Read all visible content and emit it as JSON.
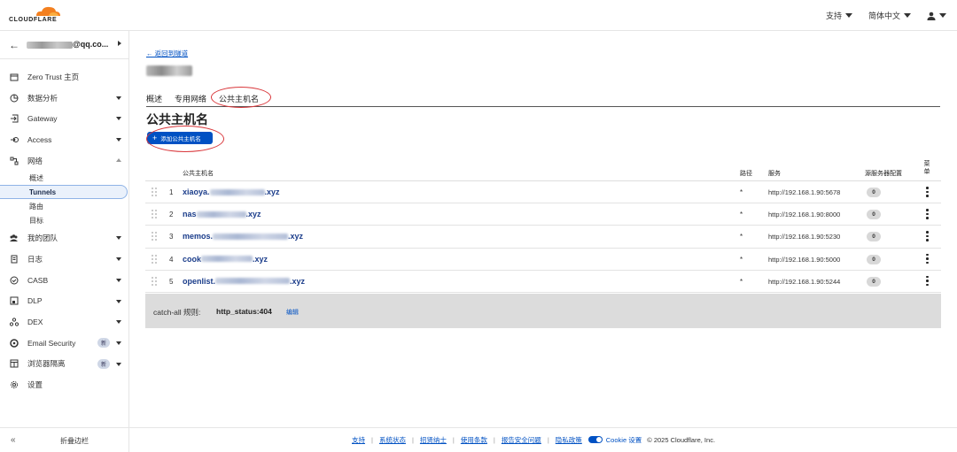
{
  "header": {
    "logo_text": "CLOUDFLARE",
    "support_label": "支持",
    "language_label": "简体中文"
  },
  "sidebar": {
    "account_name": "@qq.co...",
    "items": [
      {
        "label": "Zero Trust 主页",
        "icon": "home-icon"
      },
      {
        "label": "数据分析",
        "icon": "analytics-icon"
      },
      {
        "label": "Gateway",
        "icon": "gateway-icon"
      },
      {
        "label": "Access",
        "icon": "access-icon"
      },
      {
        "label": "网络",
        "icon": "network-icon"
      }
    ],
    "network_sub": [
      "概述",
      "Tunnels",
      "路由",
      "目标"
    ],
    "items_after": [
      {
        "label": "我的团队",
        "icon": "team-icon"
      },
      {
        "label": "日志",
        "icon": "logs-icon"
      },
      {
        "label": "CASB",
        "icon": "casb-icon"
      },
      {
        "label": "DLP",
        "icon": "dlp-icon"
      },
      {
        "label": "DEX",
        "icon": "dex-icon"
      },
      {
        "label": "Email Security",
        "icon": "email-icon",
        "badge": "新"
      },
      {
        "label": "浏览器隔离",
        "icon": "browser-icon",
        "badge": "新"
      },
      {
        "label": "设置",
        "icon": "settings-icon"
      }
    ],
    "collapse_label": "折叠边栏"
  },
  "main": {
    "back_link": "← 返回到隧道",
    "tabs": [
      "概述",
      "专用网络",
      "公共主机名"
    ],
    "active_tab": "公共主机名",
    "page_title": "公共主机名",
    "add_button": "添加公共主机名",
    "columns": {
      "hostname": "公共主机名",
      "path": "路径",
      "service": "服务",
      "origin_config": "源服务器配置",
      "menu": "菜单"
    },
    "rows": [
      {
        "num": "1",
        "prefix": "xiaoya.",
        "suffix": ".xyz",
        "path": "*",
        "service": "http://192.168.1.90:5678",
        "count": "0"
      },
      {
        "num": "2",
        "prefix": "nas",
        "suffix": ".xyz",
        "path": "*",
        "service": "http://192.168.1.90:8000",
        "count": "0"
      },
      {
        "num": "3",
        "prefix": "memos.",
        "suffix": ".xyz",
        "path": "*",
        "service": "http://192.168.1.90:5230",
        "count": "0"
      },
      {
        "num": "4",
        "prefix": "cook",
        "suffix": ".xyz",
        "path": "*",
        "service": "http://192.168.1.90:5000",
        "count": "0"
      },
      {
        "num": "5",
        "prefix": "openlist.",
        "suffix": ".xyz",
        "path": "*",
        "service": "http://192.168.1.90:5244",
        "count": "0"
      }
    ],
    "catchall": {
      "label": "catch-all 规则:",
      "value": "http_status:404",
      "edit": "编辑"
    }
  },
  "footer": {
    "links": [
      "支持",
      "系统状态",
      "招贤纳士",
      "使用条款",
      "报告安全问题",
      "隐私政策"
    ],
    "cookie_label": "Cookie 设置",
    "copyright": "© 2025 Cloudflare, Inc."
  },
  "colors": {
    "accent": "#0051c3",
    "annotation": "#d9373b",
    "brand": "#f38020"
  }
}
